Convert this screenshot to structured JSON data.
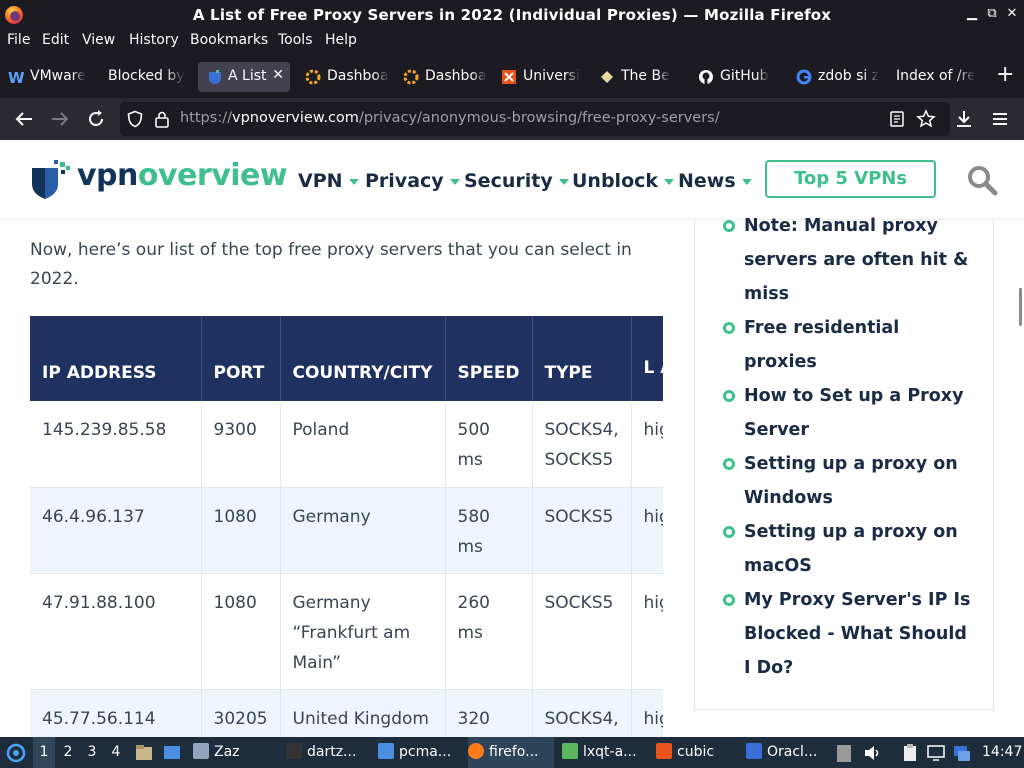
{
  "window": {
    "title": "A List of Free Proxy Servers in 2022 (Individual Proxies) — Mozilla Firefox"
  },
  "menu": [
    "File",
    "Edit",
    "View",
    "History",
    "Bookmarks",
    "Tools",
    "Help"
  ],
  "tabs": [
    {
      "label": "VMware",
      "icon": "vmware-icon"
    },
    {
      "label": "Blocked by",
      "icon": "none"
    },
    {
      "label": "A List",
      "icon": "vpnoverview-icon",
      "active": true
    },
    {
      "label": "Dashboa",
      "icon": "grafana-icon"
    },
    {
      "label": "Dashboa",
      "icon": "grafana-icon"
    },
    {
      "label": "Universi",
      "icon": "university-icon"
    },
    {
      "label": "The Be",
      "icon": "page-icon"
    },
    {
      "label": "GitHub",
      "icon": "github-icon"
    },
    {
      "label": "zdob si z",
      "icon": "google-icon"
    },
    {
      "label": "Index of /re",
      "icon": "none"
    }
  ],
  "navbar": {
    "url_prefix": "https://",
    "url_domain": "vpnoverview.com",
    "url_path": "/privacy/anonymous-browsing/free-proxy-servers/"
  },
  "site": {
    "logo_part1": "vpn",
    "logo_part2": "overview",
    "nav": [
      "VPN",
      "Privacy",
      "Security",
      "Unblock",
      "News"
    ],
    "cta": "Top 5 VPNs",
    "accent": "#3fbf8c",
    "navy": "#1f3161"
  },
  "content": {
    "intro": "Now, here’s our list of the top free proxy servers that you can select in 2022.",
    "table": {
      "headers": [
        "IP ADDRESS",
        "PORT",
        "COUNTRY/CITY",
        "SPEED",
        "TYPE",
        "L AN"
      ],
      "rows": [
        [
          "145.239.85.58",
          "9300",
          "Poland",
          "500 ms",
          "SOCKS4, SOCKS5",
          "hig"
        ],
        [
          "46.4.96.137",
          "1080",
          "Germany",
          "580 ms",
          "SOCKS5",
          "hig"
        ],
        [
          "47.91.88.100",
          "1080",
          "Germany “Frankfurt am Main”",
          "260 ms",
          "SOCKS5",
          "hig"
        ],
        [
          "45.77.56.114",
          "30205",
          "United Kingdom",
          "320",
          "SOCKS4,",
          "hig"
        ]
      ]
    }
  },
  "toc": [
    "Note: Manual proxy servers are often hit & miss",
    "Free residential proxies",
    "How to Set up a Proxy Server",
    "Setting up a proxy on Windows",
    "Setting up a proxy on macOS",
    "My Proxy Server's IP Is Blocked - What Should I Do?"
  ],
  "taskbar": {
    "workspaces": [
      "1",
      "2",
      "3",
      "4"
    ],
    "tasks": [
      "Zaz",
      "dartz...",
      "pcma...",
      "firefo...",
      "lxqt-a...",
      "cubic",
      "Oracl..."
    ],
    "clock": "14:47"
  }
}
